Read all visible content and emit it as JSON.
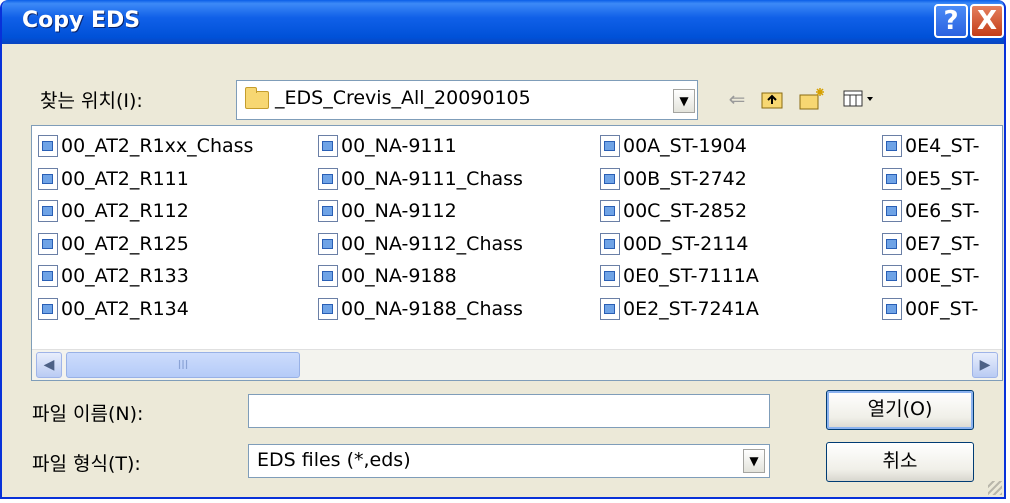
{
  "window": {
    "title": "Copy EDS"
  },
  "titlebar_buttons": {
    "help": "?",
    "close": "X"
  },
  "location": {
    "label": "찾는 위치(I):",
    "value": "_EDS_Crevis_All_20090105"
  },
  "files": [
    [
      "00_AT2_R1xx_Chass",
      "00_NA-9111",
      "00A_ST-1904",
      "0E4_ST-"
    ],
    [
      "00_AT2_R111",
      "00_NA-9111_Chass",
      "00B_ST-2742",
      "0E5_ST-"
    ],
    [
      "00_AT2_R112",
      "00_NA-9112",
      "00C_ST-2852",
      "0E6_ST-"
    ],
    [
      "00_AT2_R125",
      "00_NA-9112_Chass",
      "00D_ST-2114",
      "0E7_ST-"
    ],
    [
      "00_AT2_R133",
      "00_NA-9188",
      "0E0_ST-7111A",
      "00E_ST-"
    ],
    [
      "00_AT2_R134",
      "00_NA-9188_Chass",
      "0E2_ST-7241A",
      "00F_ST-"
    ]
  ],
  "filename": {
    "label": "파일 이름(N):",
    "value": ""
  },
  "filetype": {
    "label": "파일 형식(T):",
    "value": "EDS files (*,eds)"
  },
  "buttons": {
    "open": "열기(O)",
    "cancel": "취소"
  },
  "icons": [
    "help-icon",
    "close-icon",
    "folder-icon",
    "back-arrow-icon",
    "up-folder-icon",
    "new-folder-icon",
    "view-menu-icon",
    "file-icon",
    "dropdown-arrow-icon",
    "scroll-left-icon",
    "scroll-right-icon"
  ]
}
